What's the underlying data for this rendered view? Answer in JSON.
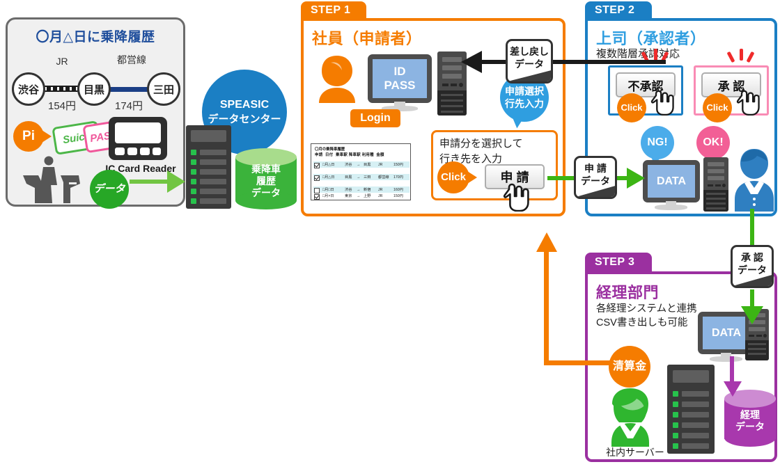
{
  "left_panel": {
    "title": "〇月△日に乗降履歴",
    "stations": [
      {
        "name": "渋谷"
      },
      {
        "name": "目黒"
      },
      {
        "name": "三田"
      }
    ],
    "lines": [
      {
        "label": "JR",
        "fare": "154円"
      },
      {
        "label": "都営線",
        "fare": "174円"
      }
    ],
    "pi_label": "Pi",
    "cards": [
      {
        "label": "Suica",
        "color": "#4cb648"
      },
      {
        "label": "PASMO",
        "color": "#f0589b"
      }
    ],
    "reader_label": "IC Card Reader",
    "data_bubble": "データ"
  },
  "datacenter": {
    "name_line1": "SPEASIC",
    "name_line2": "データセンター",
    "db_label": "乗降車\n履歴\nデータ",
    "db_line1": "乗降車",
    "db_line2": "履歴",
    "db_line3": "データ",
    "color": "#1b7fc4"
  },
  "step1": {
    "tab": "STEP 1",
    "heading": "社員（申請者）",
    "login_label": "Login",
    "monitor_text_line1": "ID",
    "monitor_text_line2": "PASS",
    "returned_tag_line1": "差し戻し",
    "returned_tag_line2": "データ",
    "balloon_line1": "申請選択",
    "balloon_line2": "行先入力",
    "instruction_line1": "申請分を選択して",
    "instruction_line2": "行き先を入力",
    "click_label": "Click",
    "apply_button": "申 請",
    "color": "#f57c00",
    "mini_table": {
      "title": "〇月の乗降車履歴",
      "headers": [
        "申請",
        "日付",
        "乗車駅",
        "降車駅",
        "利用種",
        "金額"
      ],
      "rows": [
        {
          "checked": true,
          "date": "□月△日",
          "from": "渋谷",
          "to": "目黒",
          "line": "JR",
          "fare": "150円"
        },
        {
          "checked": true,
          "date": "□月△日",
          "from": "目黒",
          "to": "三田",
          "line": "都営線",
          "fare": "170円"
        },
        {
          "checked": false,
          "date": "□月□日",
          "from": "渋谷",
          "to": "新宿",
          "line": "JR",
          "fare": "160円"
        },
        {
          "checked": true,
          "date": "□月×日",
          "from": "東京",
          "to": "上野",
          "line": "JR",
          "fare": "150円"
        }
      ]
    }
  },
  "step2": {
    "tab": "STEP 2",
    "heading": "上司（承認者）",
    "subtitle": "複数階層承認対応",
    "reject_button": "不承認",
    "approve_button": "承 認",
    "click_label": "Click",
    "ng_label": "NG!",
    "ok_label": "OK!",
    "data_screen": "DATA",
    "color": "#1b7fc4",
    "reject_color": "#1b7fc4",
    "approve_color": "#f98bb4"
  },
  "step3": {
    "tab": "STEP 3",
    "heading": "経理部門",
    "subtitle_line1": "各経理システムと連携",
    "subtitle_line2": "CSV書き出しも可能",
    "data_screen": "DATA",
    "settlement_label": "清算金",
    "server_caption": "社内サーバー",
    "db_line1": "経理",
    "db_line2": "データ",
    "color": "#9b30a0"
  },
  "connectors": {
    "apply_tag_line1": "申 請",
    "apply_tag_line2": "データ",
    "approve_tag_line1": "承 認",
    "approve_tag_line2": "データ"
  }
}
